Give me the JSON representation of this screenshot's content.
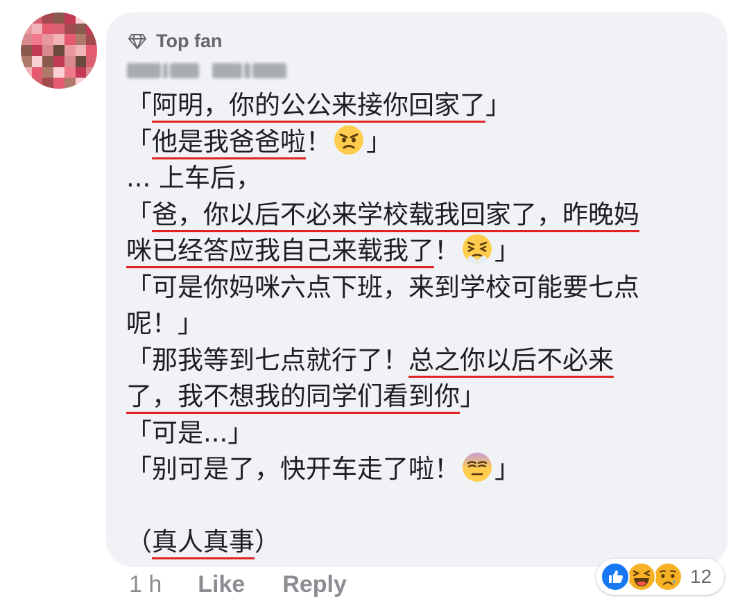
{
  "comment": {
    "badge_label": "Top fan",
    "lines": [
      [
        {
          "t": "「"
        },
        {
          "t": "阿明，你的公公来接你回家了",
          "u": true
        },
        {
          "t": "」"
        }
      ],
      [
        {
          "t": "「"
        },
        {
          "t": "他是我爸爸啦",
          "u": true
        },
        {
          "t": "！"
        },
        {
          "e": "angry"
        },
        {
          "t": "」"
        }
      ],
      [
        {
          "t": "... 上车后，"
        }
      ],
      [
        {
          "t": "「"
        },
        {
          "t": "爸，你以后不必来学校载我回家了，昨晚妈",
          "u": true
        }
      ],
      [
        {
          "t": "咪已经答应我自己来载我了",
          "u": true
        },
        {
          "t": "！"
        },
        {
          "e": "steam"
        },
        {
          "t": "」"
        }
      ],
      [
        {
          "t": "「可是你妈咪六点下班，来到学校可能要七点"
        }
      ],
      [
        {
          "t": "呢！」"
        }
      ],
      [
        {
          "t": "「那我等到七点就行了！"
        },
        {
          "t": "总之你以后不必来",
          "u": true
        }
      ],
      [
        {
          "t": "了，我不想我的同学们看到你",
          "u": true
        },
        {
          "t": "」"
        }
      ],
      [
        {
          "t": "「可是...」"
        }
      ],
      [
        {
          "t": "「别可是了，快开车走了啦！"
        },
        {
          "e": "eyeroll"
        },
        {
          "t": "」"
        }
      ],
      [],
      [
        {
          "t": " （"
        },
        {
          "t": "真人真事",
          "u": true
        },
        {
          "t": "）"
        }
      ]
    ]
  },
  "actions": {
    "time": "1 h",
    "like_label": "Like",
    "reply_label": "Reply"
  },
  "reactions": {
    "icons": [
      "like-icon",
      "haha-icon",
      "sad-icon"
    ],
    "count": "12"
  },
  "colors": {
    "bubble": "#f0f2f5",
    "underline": "#e02424",
    "meta_text": "#65676b",
    "like_blue": "#1877f2",
    "emoji_yellow": "#ffcc4d"
  }
}
